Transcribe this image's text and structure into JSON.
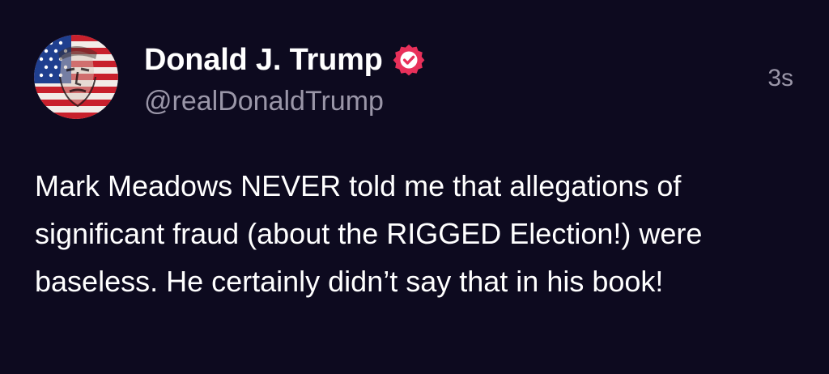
{
  "post": {
    "author": {
      "display_name": "Donald J. Trump",
      "handle": "@realDonaldTrump",
      "verified_icon": "verified-badge-icon",
      "verified_color": "#e8305a"
    },
    "timestamp": "3s",
    "text": "Mark Meadows NEVER told me that allegations of significant fraud (about the RIGGED Election!) were baseless. He certainly didn’t say that in his book!"
  },
  "colors": {
    "background": "#0d0a1f",
    "primary_text": "#ffffff",
    "secondary_text": "#9a96a8"
  }
}
